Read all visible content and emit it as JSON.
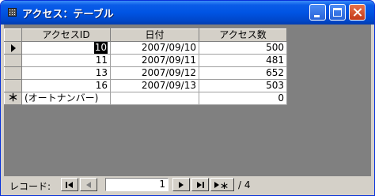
{
  "window": {
    "title": "アクセス：テーブル",
    "colors": {
      "titlebar": "#0054e3",
      "face": "#d4d0c8",
      "background": "#808080"
    }
  },
  "table": {
    "columns": [
      "アクセスID",
      "日付",
      "アクセス数"
    ],
    "rows": [
      {
        "id": "10",
        "date": "2007/09/10",
        "count": "500"
      },
      {
        "id": "11",
        "date": "2007/09/11",
        "count": "481"
      },
      {
        "id": "13",
        "date": "2007/09/12",
        "count": "652"
      },
      {
        "id": "16",
        "date": "2007/09/13",
        "count": "503"
      }
    ],
    "new_row": {
      "id": "(オートナンバー)",
      "date": "",
      "count": "0"
    },
    "new_row_marker": "＊"
  },
  "navigation": {
    "label": "レコード:",
    "current_record": "1",
    "total": "/ 4",
    "buttons": [
      "first-record",
      "previous-record",
      "next-record",
      "last-record",
      "new-record"
    ]
  }
}
